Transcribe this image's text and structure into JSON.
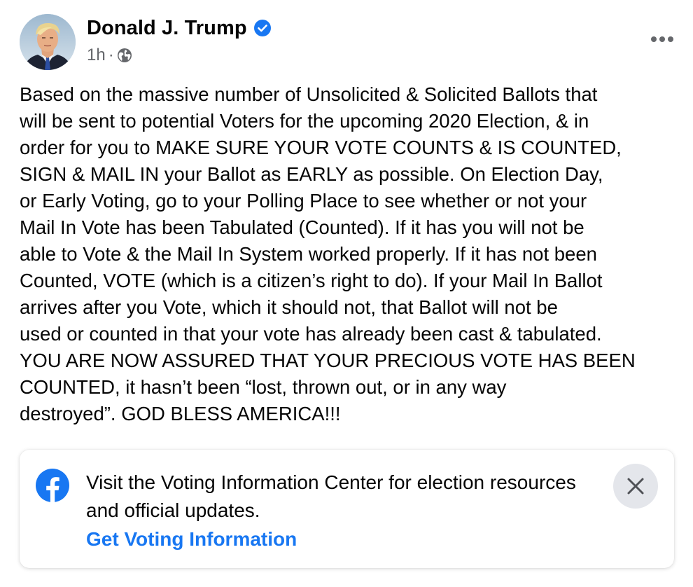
{
  "post": {
    "author": "Donald J. Trump",
    "verified_icon": "verified-badge-icon",
    "timestamp": "1h",
    "separator": "·",
    "audience_icon": "globe-icon",
    "more_icon": "more-options-icon",
    "text": "Based on the massive number of Unsolicited & Solicited Ballots that\nwill be sent to potential Voters for the upcoming 2020 Election, & in\norder for you to MAKE SURE YOUR VOTE COUNTS & IS COUNTED,\nSIGN & MAIL IN your Ballot as EARLY as possible. On Election Day,\nor Early Voting, go to your Polling Place to see whether or not your\nMail In Vote has been Tabulated (Counted). If it has you will not be\nable to Vote & the Mail In System worked properly. If it has not been\nCounted, VOTE (which is a citizen’s right to do). If your Mail In Ballot\narrives after you Vote, which it should not, that Ballot will not be\nused or counted in that your vote has already been cast & tabulated.\nYOU ARE NOW ASSURED THAT YOUR PRECIOUS VOTE HAS BEEN\nCOUNTED, it hasn’t been “lost, thrown out, or in any way\ndestroyed”. GOD BLESS AMERICA!!!"
  },
  "notice": {
    "icon": "facebook-logo-icon",
    "text": "Visit the Voting Information Center for election resources and official updates.",
    "link_label": "Get Voting Information",
    "close_icon": "close-icon"
  },
  "colors": {
    "link": "#1877f2",
    "verified": "#1877f2",
    "meta": "#65676b",
    "close_bg": "#e4e6eb"
  }
}
